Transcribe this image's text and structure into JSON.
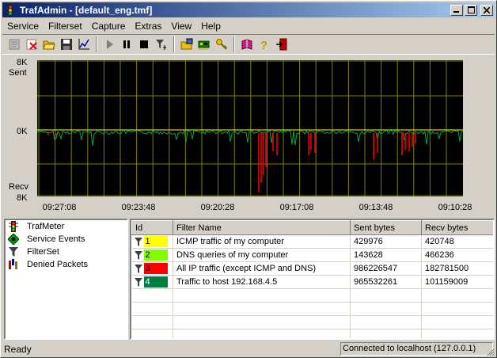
{
  "window": {
    "title": "TrafAdmin - [default_eng.tmf]"
  },
  "menu": [
    "Service",
    "Filterset",
    "Capture",
    "Extras",
    "View",
    "Help"
  ],
  "toolbar": {
    "groups": [
      [
        "properties-icon",
        "delete-icon",
        "open-folder-icon",
        "save-icon",
        "chart-icon"
      ],
      [
        "play-icon",
        "pause-icon",
        "stop-icon",
        "filter-config-icon"
      ],
      [
        "open-settings-icon",
        "network-card-icon",
        "key-icon"
      ],
      [
        "book-icon",
        "help-icon",
        "exit-icon"
      ]
    ]
  },
  "graph": {
    "y_top_value": "8K",
    "y_top_label": "Sent",
    "y_mid_value": "0K",
    "y_bottom_label": "Recv",
    "y_bottom_value": "8K",
    "time_labels": [
      "09:27:08",
      "09:23:48",
      "09:20:28",
      "09:17:08",
      "09:13:48",
      "09:10:28"
    ],
    "colors": {
      "background": "#000000",
      "grid": "#808000",
      "baseline": "#ffff00",
      "sent": "#00aa40",
      "recv": "#ff0000"
    }
  },
  "tree": {
    "items": [
      {
        "label": "TrafMeter",
        "icon": "traffic-light-icon"
      },
      {
        "label": "Service Events",
        "icon": "service-events-icon"
      },
      {
        "label": "FilterSet",
        "icon": "funnel-icon"
      },
      {
        "label": "Denied Packets",
        "icon": "denied-packets-icon"
      }
    ]
  },
  "table": {
    "columns": [
      "Id",
      "Filter Name",
      "Sent bytes",
      "Recv bytes"
    ],
    "rows": [
      {
        "id": "1",
        "color": "#ffff00",
        "name": "ICMP traffic of my computer",
        "sent": "429976",
        "recv": "420748"
      },
      {
        "id": "2",
        "color": "#80ff00",
        "name": "DNS queries of my computer",
        "sent": "143628",
        "recv": "466236"
      },
      {
        "id": "3",
        "color": "#ff0000",
        "name": "All IP traffic (except ICMP and DNS)",
        "sent": "986226547",
        "recv": "182781500"
      },
      {
        "id": "4",
        "color": "#008040",
        "name": "Traffic to host 192.168.4.5",
        "sent": "965532261",
        "recv": "101159009"
      }
    ],
    "empty_rows": 4
  },
  "status": {
    "left": "Ready",
    "right": "Connected to localhost (127.0.0.1)"
  }
}
